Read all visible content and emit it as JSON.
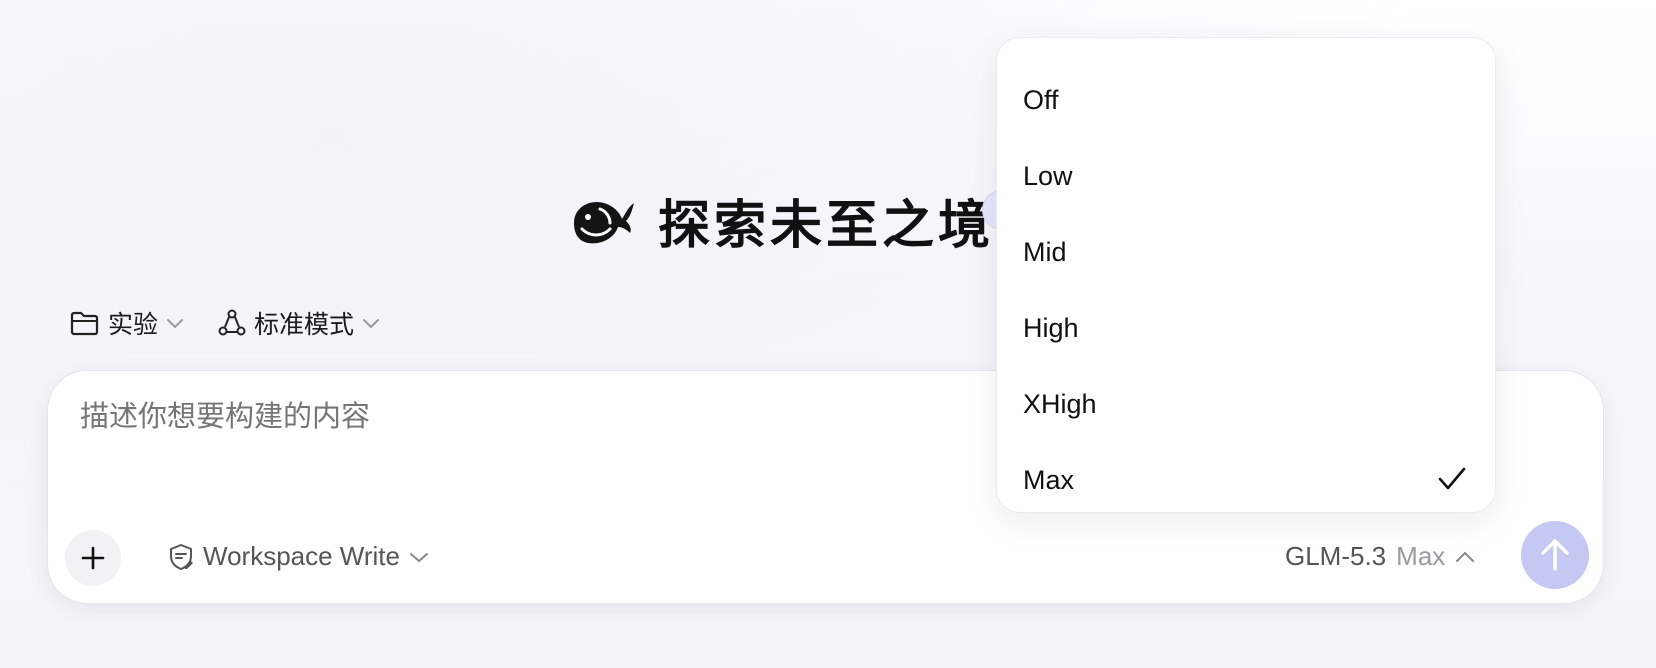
{
  "hero": {
    "title": "探索未至之境",
    "logo_icon": "whale-logo-icon"
  },
  "selectors": {
    "folder": {
      "label": "实验",
      "icon": "folder-icon"
    },
    "mode": {
      "label": "标准模式",
      "icon": "nodes-icon"
    }
  },
  "composer": {
    "placeholder": "描述你想要构建的内容",
    "permission": {
      "label": "Workspace Write",
      "icon": "shield-edit-icon"
    },
    "model": {
      "name": "GLM-5.3",
      "level": "Max"
    },
    "send_icon": "arrow-up-icon",
    "attach_icon": "plus-icon"
  },
  "dropdown": {
    "options": [
      "Off",
      "Low",
      "Mid",
      "High",
      "XHigh",
      "Max"
    ],
    "selected": "Max"
  },
  "colors": {
    "send_button": "#c4c8f2",
    "badge": "#e6e8fb",
    "placeholder": "#a8a8ae"
  }
}
